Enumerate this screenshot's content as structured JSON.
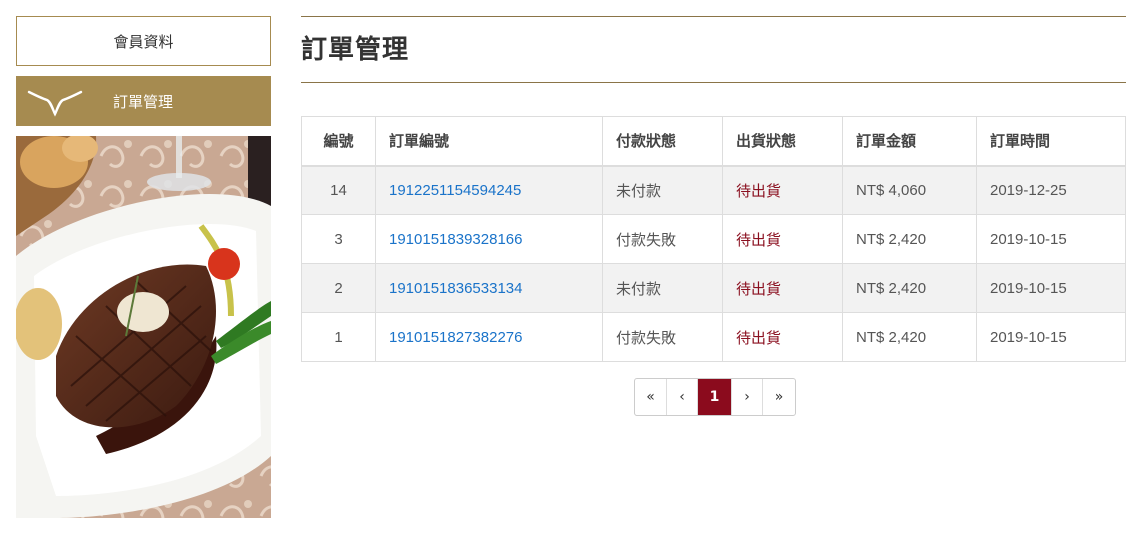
{
  "sidebar": {
    "member_label": "會員資料",
    "orders_label": "訂單管理"
  },
  "main": {
    "title": "訂單管理"
  },
  "table": {
    "headers": [
      "編號",
      "訂單編號",
      "付款狀態",
      "出貨狀態",
      "訂單金額",
      "訂單時間"
    ],
    "rows": [
      [
        "14",
        "1912251154594245",
        "未付款",
        "待出貨",
        "NT$ 4,060",
        "2019-12-25"
      ],
      [
        "3",
        "1910151839328166",
        "付款失敗",
        "待出貨",
        "NT$ 2,420",
        "2019-10-15"
      ],
      [
        "2",
        "1910151836533134",
        "未付款",
        "待出貨",
        "NT$ 2,420",
        "2019-10-15"
      ],
      [
        "1",
        "1910151827382276",
        "付款失敗",
        "待出貨",
        "NT$ 2,420",
        "2019-10-15"
      ]
    ]
  },
  "pagination": {
    "first": "«",
    "prev": "‹",
    "current": "1",
    "next": "›",
    "last": "»"
  },
  "colors": {
    "gold": "#a68b50",
    "active_page": "#8b0b1d",
    "link": "#1a73c9",
    "ship_status": "#8b1020"
  },
  "icons": {
    "logo": "longhorn-icon"
  }
}
